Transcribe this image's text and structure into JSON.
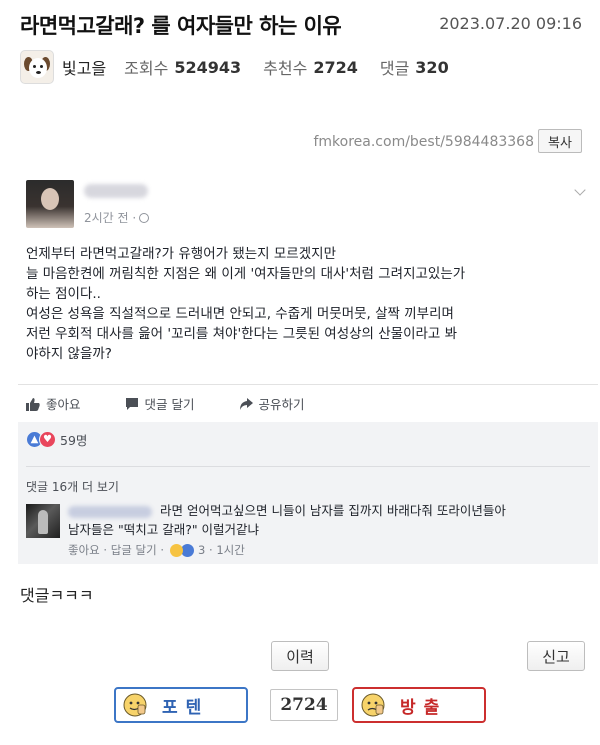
{
  "header": {
    "title": "라면먹고갈래? 를 여자들만 하는 이유",
    "datetime": "2023.07.20 09:16"
  },
  "meta": {
    "author": "빛고을",
    "views_label": "조회수",
    "views": "524943",
    "recommend_label": "추천수",
    "recommend": "2724",
    "comments_label": "댓글",
    "comments": "320"
  },
  "source": {
    "url": "fmkorea.com/best/5984483368",
    "copy_label": "복사"
  },
  "post": {
    "time": "2시간 전 ·",
    "lines": [
      "언제부터 라면먹고갈래?가 유행어가 됐는지 모르겠지만",
      "늘 마음한켠에 꺼림칙한 지점은 왜 이게 '여자들만의 대사'처럼 그려지고있는가",
      "하는 점이다..",
      "여성은 성욕을 직설적으로 드러내면 안되고, 수줍게 머뭇머뭇, 살짝 끼부리며",
      "저런 우회적 대사를 읊어 '꼬리를 쳐야'한다는 그릇된 여성상의 산물이라고 봐",
      "야하지 않을까?"
    ],
    "actions": {
      "like": "좋아요",
      "comment": "댓글 달기",
      "share": "공유하기"
    },
    "reaction_count": "59명",
    "more_comments": "댓글 16개 더 보기"
  },
  "comment": {
    "line1": "라면 얻어먹고싶으면 니들이 남자를 집까지 바래다줘 또라이년들아",
    "line2": "남자들은 \"떡치고 갈래?\" 이럴거같냐",
    "like": "좋아요",
    "reply": "답글 달기",
    "reaction_count": "3",
    "time": "1시간"
  },
  "footer": {
    "text": "댓글ㅋㅋㅋ",
    "history_label": "이력",
    "report_label": "신고",
    "upvote_label": "포텐",
    "vote_count": "2724",
    "downvote_label": "방출"
  }
}
